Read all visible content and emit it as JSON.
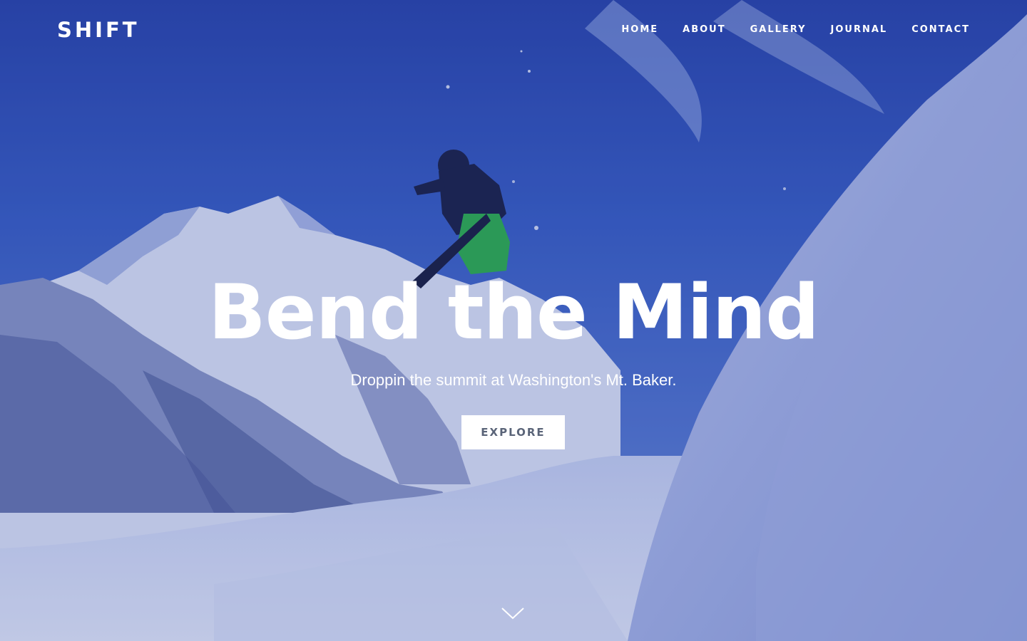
{
  "brand": {
    "logo_text": "SHIFT"
  },
  "nav": {
    "items": [
      {
        "label": "HOME"
      },
      {
        "label": "ABOUT"
      },
      {
        "label": "GALLERY"
      },
      {
        "label": "JOURNAL"
      },
      {
        "label": "CONTACT"
      }
    ]
  },
  "hero": {
    "headline": "Bend the Mind",
    "subheadline": "Droppin the summit at Washington's Mt. Baker.",
    "cta_label": "EXPLORE",
    "scroll_icon": "chevron-down-icon",
    "background_image": "snowboarder-mountain-photo"
  },
  "colors": {
    "sky": "#2f4fb0",
    "snow": "#e3e8f6",
    "text": "#ffffff",
    "button_bg": "#ffffff",
    "button_text": "#5a6478"
  }
}
